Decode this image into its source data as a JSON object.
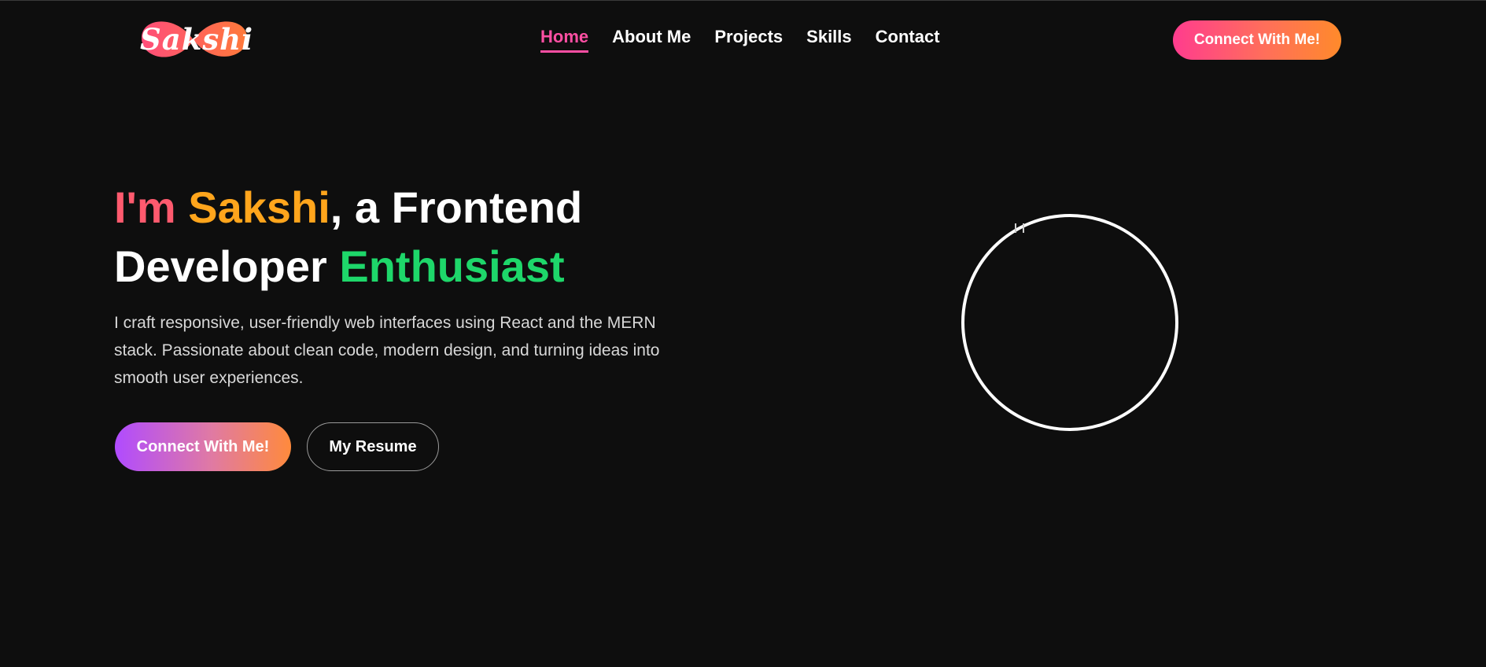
{
  "brand": {
    "logo_text": "Sakshi"
  },
  "nav": {
    "items": [
      {
        "label": "Home",
        "active": true
      },
      {
        "label": "About Me",
        "active": false
      },
      {
        "label": "Projects",
        "active": false
      },
      {
        "label": "Skills",
        "active": false
      },
      {
        "label": "Contact",
        "active": false
      }
    ],
    "cta_label": "Connect With Me!"
  },
  "hero": {
    "title_part1": "I'm",
    "title_name": "Sakshi",
    "title_part2": ", a Frontend",
    "title_part3": "Developer",
    "title_part4": "Enthusiast",
    "description": "I craft responsive, user-friendly web interfaces using React and the MERN stack. Passionate about clean code, modern design, and turning ideas into smooth user experiences.",
    "primary_button": "Connect With Me!",
    "secondary_button": "My Resume"
  },
  "colors": {
    "background": "#0e0e0e",
    "accent_pink": "#ff4fa3",
    "title_pink": "#ff5a6e",
    "title_orange": "#ffa51c",
    "title_green": "#1ed76a",
    "gradient_start": "#ff3c8e",
    "gradient_end": "#ff8a2b"
  },
  "icons": {
    "logo": "logo-blob-icon",
    "profile_image": "broken-image-icon"
  }
}
